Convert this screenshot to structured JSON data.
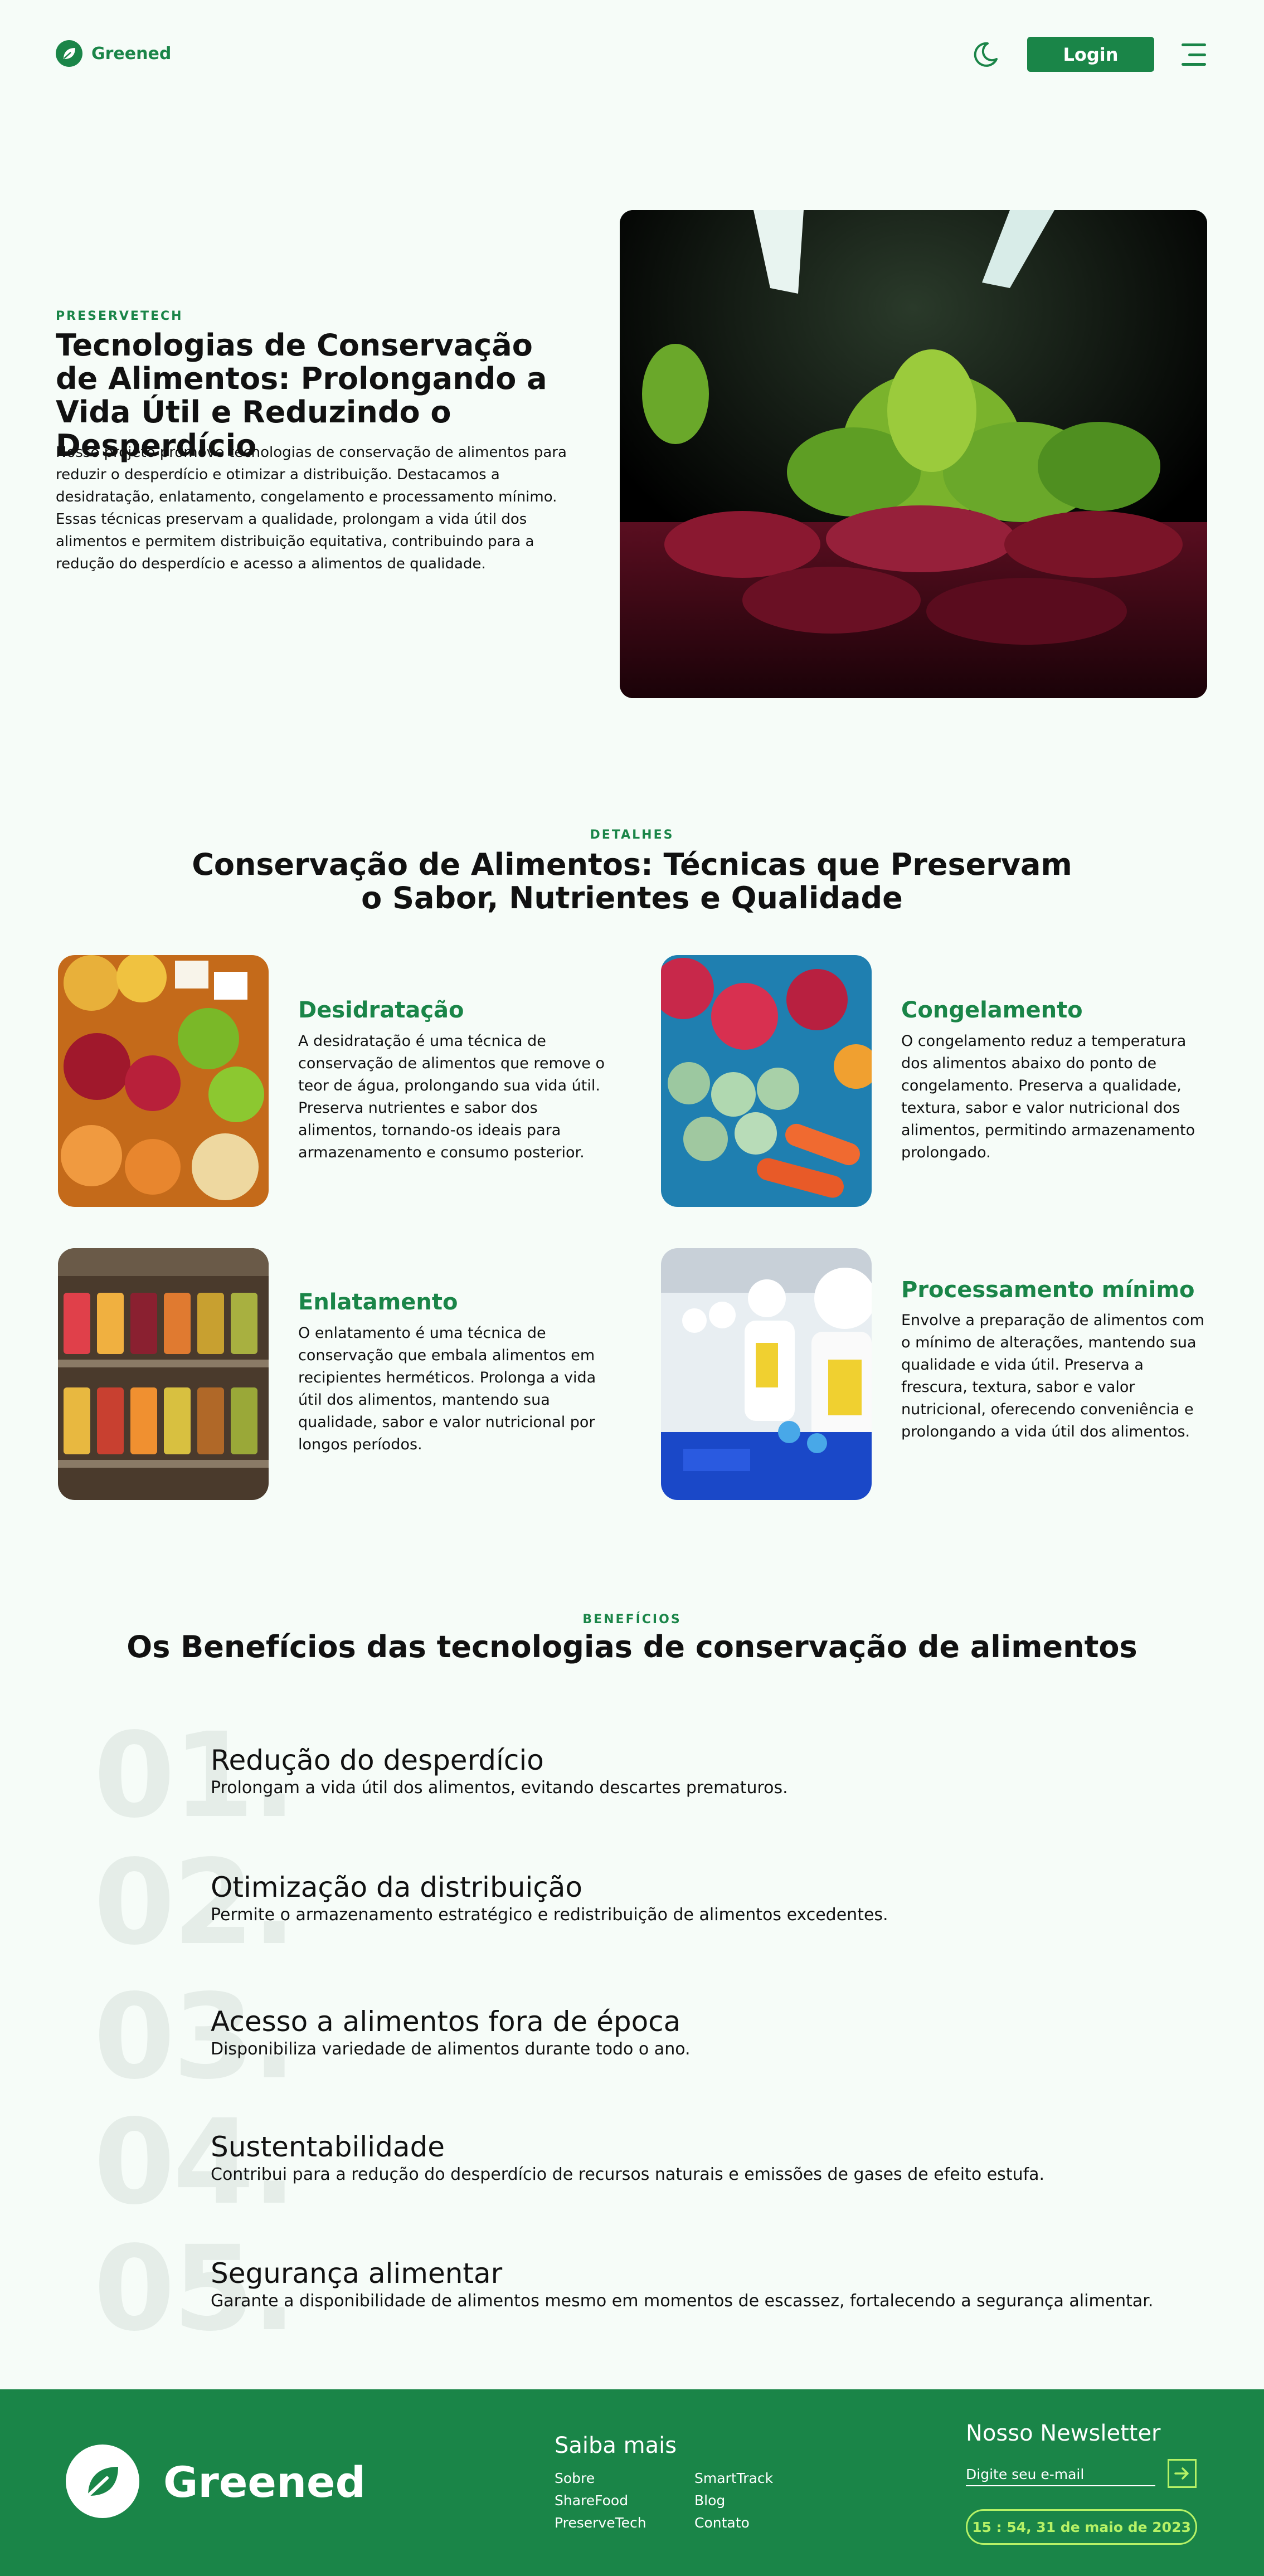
{
  "header": {
    "brand": "Greened",
    "login_label": "Login"
  },
  "hero": {
    "eyebrow": "PRESERVETECH",
    "title": "Tecnologias de Conservação de Alimentos: Prolongando a Vida Útil e Reduzindo o Desperdício",
    "text": "Nosso projeto promove tecnologias de conservação de alimentos para reduzir o desperdício e otimizar a distribuição. Destacamos a desidratação, enlatamento, congelamento e processamento mínimo. Essas técnicas preservam a qualidade, prolongam a vida útil dos alimentos e permitem distribuição equitativa, contribuindo para a redução do desperdício e acesso a alimentos de qualidade."
  },
  "details": {
    "eyebrow": "DETALHES",
    "title": "Conservação de Alimentos: Técnicas que Preservam o Sabor, Nutrientes e Qualidade",
    "cards": [
      {
        "title": "Desidratação",
        "text": "A desidratação é uma técnica de conservação de alimentos que remove o teor de água, prolongando sua vida útil. Preserva nutrientes e sabor dos alimentos, tornando-os ideais para armazenamento e consumo posterior."
      },
      {
        "title": "Congelamento",
        "text": "O congelamento reduz a temperatura dos alimentos abaixo do ponto de congelamento. Preserva a qualidade, textura, sabor e valor nutricional dos alimentos, permitindo armazenamento prolongado."
      },
      {
        "title": "Enlatamento",
        "text": "O enlatamento é uma técnica de conservação que embala alimentos em recipientes herméticos. Prolonga a vida útil dos alimentos, mantendo sua qualidade, sabor e valor nutricional por longos períodos."
      },
      {
        "title": "Processamento mínimo",
        "text": "Envolve a preparação de alimentos com o mínimo de alterações, mantendo sua qualidade e vida útil. Preserva a frescura, textura, sabor e valor nutricional, oferecendo conveniência e prolongando a vida útil dos alimentos."
      }
    ]
  },
  "benefits": {
    "eyebrow": "BENEFÍCIOS",
    "title": "Os Benefícios das tecnologias de conservação de alimentos",
    "items": [
      {
        "num": "01.",
        "title": "Redução do desperdício",
        "text": "Prolongam a vida útil dos alimentos, evitando descartes prematuros."
      },
      {
        "num": "02.",
        "title": "Otimização da distribuição",
        "text": "Permite o armazenamento estratégico e redistribuição de alimentos excedentes."
      },
      {
        "num": "03.",
        "title": "Acesso a alimentos fora de época",
        "text": "Disponibiliza variedade de alimentos durante todo o ano."
      },
      {
        "num": "04.",
        "title": "Sustentabilidade",
        "text": "Contribui para a redução do desperdício de recursos naturais e emissões de gases de efeito estufa."
      },
      {
        "num": "05.",
        "title": "Segurança alimentar",
        "text": "Garante a disponibilidade de alimentos mesmo em momentos de escassez, fortalecendo a segurança alimentar."
      }
    ]
  },
  "footer": {
    "brand": "Greened",
    "links_title": "Saiba mais",
    "links": [
      "Sobre",
      "ShareFood",
      "PreserveTech",
      "SmartTrack",
      "Blog",
      "Contato"
    ],
    "newsletter_title": "Nosso Newsletter",
    "newsletter_placeholder": "Digite seu e-mail",
    "clock": "15 : 54, 31 de maio de 2023"
  },
  "colors": {
    "brand": "#1a8548",
    "accent": "#b6f266",
    "background": "#f6fcf8"
  },
  "icons": [
    "leaf-icon",
    "moon-icon",
    "menu-icon",
    "arrow-right-icon"
  ]
}
